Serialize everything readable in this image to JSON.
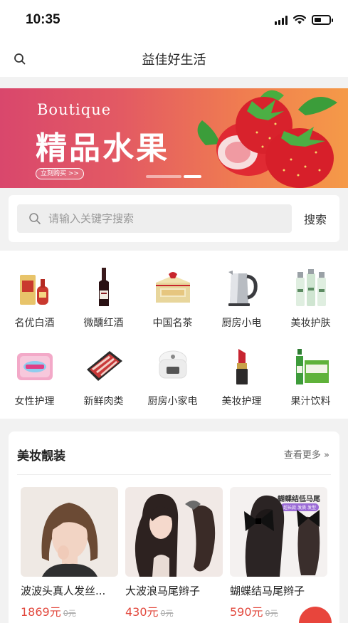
{
  "status_bar": {
    "time": "10:35"
  },
  "header": {
    "title": "益佳好生活"
  },
  "banner": {
    "subtitle": "Boutique",
    "title": "精品水果",
    "cta": "立刻购买 >>"
  },
  "search": {
    "placeholder": "请输入关键字搜索",
    "button": "搜索"
  },
  "categories": [
    {
      "label": "名优白酒",
      "icon": "baijiu-icon"
    },
    {
      "label": "微醺红酒",
      "icon": "red-wine-icon"
    },
    {
      "label": "中国名茶",
      "icon": "tea-icon"
    },
    {
      "label": "厨房小电",
      "icon": "kettle-icon"
    },
    {
      "label": "美妆护肤",
      "icon": "skincare-icon"
    },
    {
      "label": "女性护理",
      "icon": "sanitary-pad-icon"
    },
    {
      "label": "新鲜肉类",
      "icon": "meat-icon"
    },
    {
      "label": "厨房小家电",
      "icon": "rice-cooker-icon"
    },
    {
      "label": "美妆护理",
      "icon": "lipstick-icon"
    },
    {
      "label": "果汁饮料",
      "icon": "juice-icon"
    }
  ],
  "products_section": {
    "title": "美妆靓装",
    "more": "查看更多 »",
    "items": [
      {
        "name": "波波头真人发丝...",
        "price": "1869元",
        "original_price": "0元"
      },
      {
        "name": "大波浪马尾辫子",
        "price": "430元",
        "original_price": "0元"
      },
      {
        "name": "蝴蝶结马尾辫子",
        "price": "590元",
        "original_price": "0元",
        "image_caption": "蝴蝶结低马尾",
        "image_tag": "超长款 发质 发型"
      }
    ]
  },
  "colors": {
    "accent": "#e2483d",
    "banner_start": "#d9476c",
    "banner_end": "#f59a48"
  }
}
